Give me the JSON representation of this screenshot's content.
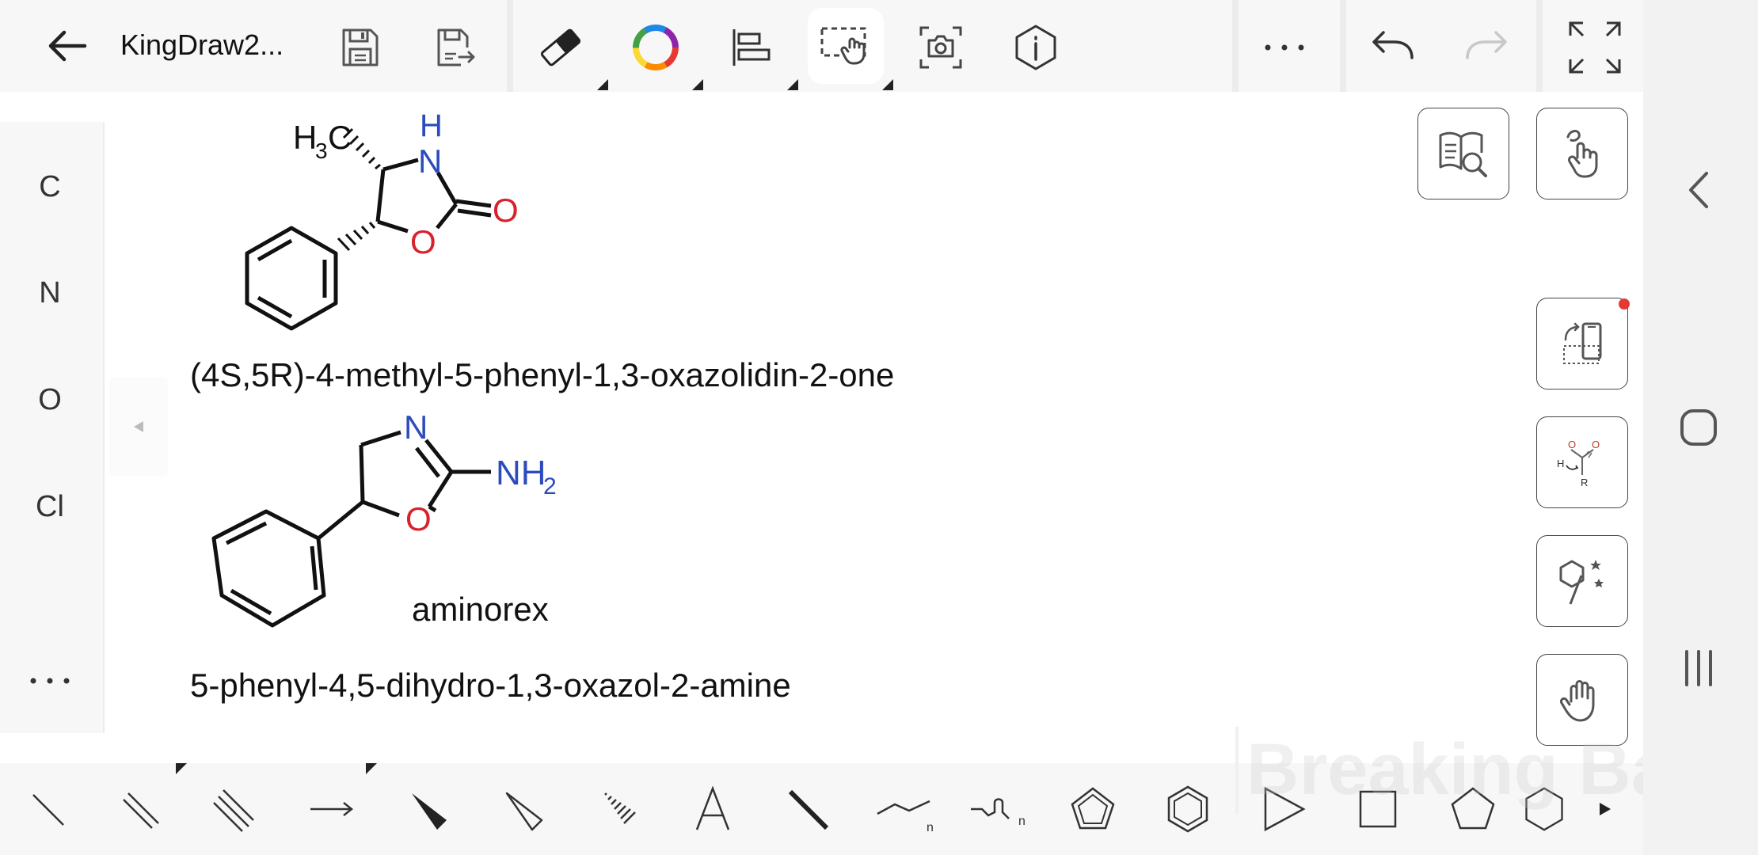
{
  "app": {
    "title": "KingDraw2...",
    "watermark": "Breaking Bad"
  },
  "toolbar": {
    "back": "back-arrow-icon",
    "save": "save-icon",
    "export": "export-icon",
    "eraser": "eraser-icon",
    "color": "color-ring-icon",
    "align": "align-icon",
    "select": "select-icon",
    "screenshot": "screenshot-icon",
    "info": "info-icon",
    "more": "more-icon",
    "undo": "undo-icon",
    "redo": "redo-icon",
    "fullscreen": "fullscreen-icon"
  },
  "atom_panel": {
    "items": [
      "C",
      "N",
      "O",
      "Cl"
    ],
    "more": "more-icon"
  },
  "canvas": {
    "molecules": [
      {
        "name": "(4S,5R)-4-methyl-5-phenyl-1,3-oxazolidin-2-one",
        "labels": {
          "methyl_h": "H",
          "methyl_sub": "3",
          "methyl_c": "C",
          "nh_h": "H",
          "n": "N",
          "o_ring": "O",
          "o_carbonyl": "O"
        }
      },
      {
        "name": "5-phenyl-4,5-dihydro-1,3-oxazol-2-amine",
        "common_name": "aminorex",
        "labels": {
          "n": "N",
          "o": "O",
          "nh": "NH",
          "nh_sub": "2"
        }
      }
    ],
    "colors": {
      "nitrogen": "#2c4bbd",
      "oxygen": "#d8212a",
      "bond": "#111111"
    }
  },
  "right_panel": {
    "items": [
      "reference-search-icon",
      "gesture-draw-icon",
      "screen-rotate-icon",
      "reaction-mechanism-icon",
      "chiral-center-icon",
      "hand-pan-icon"
    ],
    "reaction_labels": {
      "h": "H",
      "r": "R",
      "o1": "O",
      "o2": "O"
    },
    "notification_color": "#e53935"
  },
  "bottom_tools": [
    "single-bond-icon",
    "double-bond-icon",
    "triple-bond-icon",
    "arrow-icon",
    "wedge-bond-icon",
    "hollow-wedge-bond-icon",
    "hash-bond-icon",
    "text-icon",
    "bold-bond-icon",
    "chain-icon",
    "chain-n-icon",
    "cyclopentadiene-icon",
    "benzene-icon",
    "triangle-ring-icon",
    "square-ring-icon",
    "pentagon-ring-icon",
    "hexagon-ring-icon",
    "next-icon"
  ],
  "bottom_labels": {
    "chain_n": "n",
    "chain2_n": "n"
  },
  "nav": {
    "back": "nav-back-icon",
    "home": "nav-home-icon",
    "recents": "nav-recents-icon"
  }
}
